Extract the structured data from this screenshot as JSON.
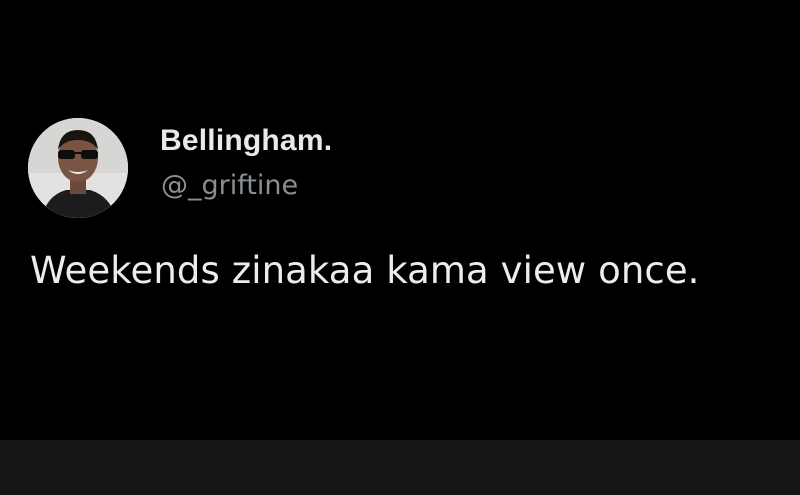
{
  "tweet": {
    "display_name": "Bellingham.",
    "handle": "@_griftine",
    "text": "Weekends zinakaa kama view once."
  },
  "colors": {
    "background": "#000000",
    "name_text": "#e9e9e9",
    "handle_text": "#8a8f94",
    "body_text": "#ececec"
  }
}
